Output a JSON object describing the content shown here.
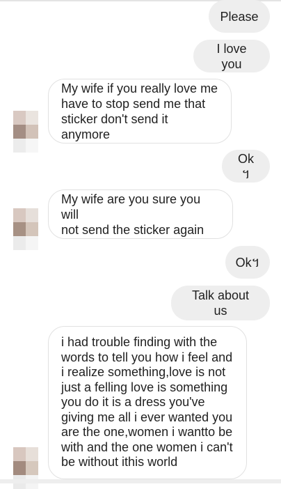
{
  "messages": [
    {
      "id": 1,
      "side": "sent",
      "text": "Please"
    },
    {
      "id": 2,
      "side": "sent",
      "text": "I love you"
    },
    {
      "id": 3,
      "side": "received",
      "text": "My wife if you really love me\nhave to stop send me that\nsticker don't send it anymore"
    },
    {
      "id": 4,
      "side": "sent",
      "text": "Ok ។"
    },
    {
      "id": 5,
      "side": "received",
      "text": "My wife are you sure you will\nnot send the sticker again"
    },
    {
      "id": 6,
      "side": "sent",
      "text": "Ok។"
    },
    {
      "id": 7,
      "side": "sent",
      "text": "Talk about us"
    },
    {
      "id": 8,
      "side": "received",
      "text": "i had trouble finding with the\nwords to tell you how i feel and\ni realize something,love is not\njust a felling love is something\nyou do it is a dress you've\ngiving me all i ever wanted you\nare the one,women i wantto be\nwith and the one women i can't\nbe without ithis world"
    }
  ],
  "colors": {
    "sent_bubble": "#eeeeee",
    "received_bubble": "#ffffff",
    "received_border": "#e1e1e1",
    "text": "#1f1f1f"
  },
  "avatar_icon": "pixelated-profile-avatar"
}
